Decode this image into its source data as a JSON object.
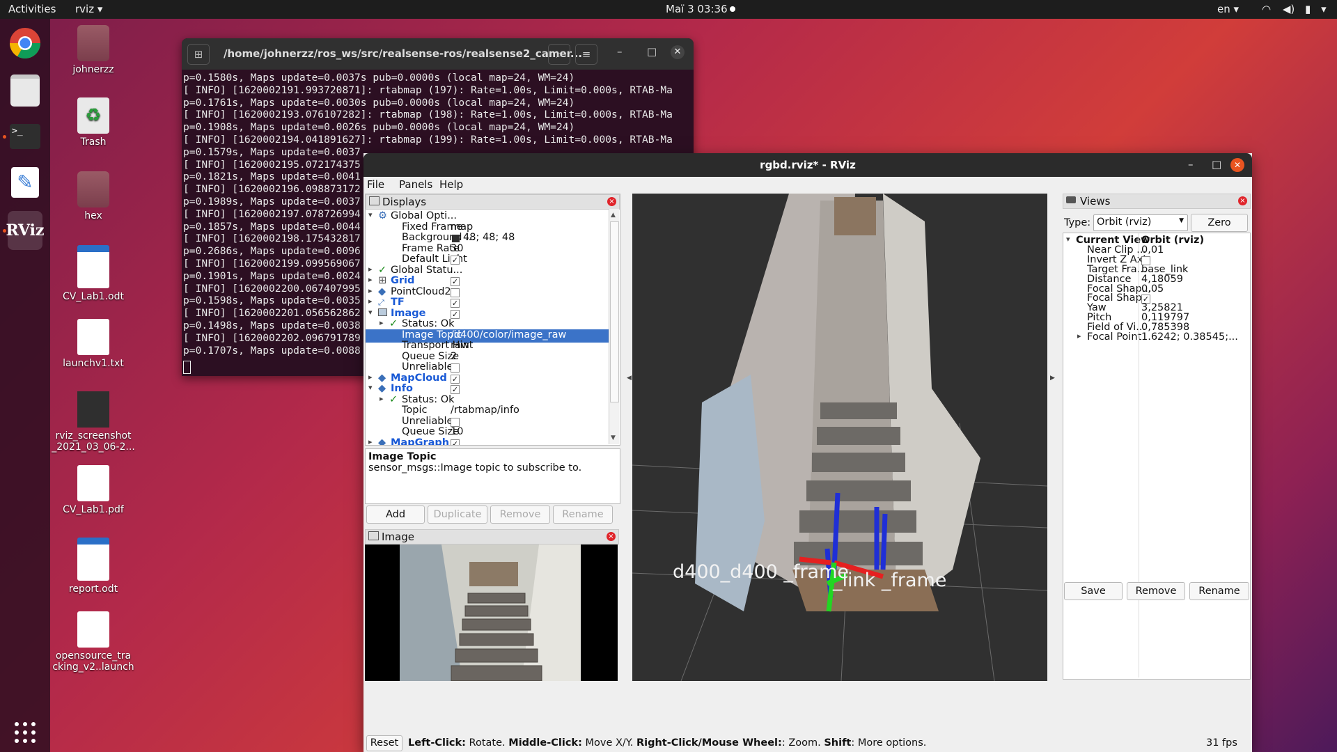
{
  "topbar": {
    "activities": "Activities",
    "app": "rviz ▾",
    "clock": "Маї 3  03:36",
    "lang": "en ▾"
  },
  "desktop": [
    {
      "label": "johnerzz"
    },
    {
      "label": "Trash"
    },
    {
      "label": "hex"
    },
    {
      "label": "CV_Lab1.odt"
    },
    {
      "label": "launchv1.txt"
    },
    {
      "label": "rviz_screenshot\n_2021_03_06-2..."
    },
    {
      "label": "CV_Lab1.pdf"
    },
    {
      "label": "report.odt"
    },
    {
      "label": "opensource_tra\ncking_v2..launch"
    }
  ],
  "terminal": {
    "title": "/home/johnerzz/ros_ws/src/realsense-ros/realsense2_camer...",
    "lines": [
      "p=0.1580s, Maps update=0.0037s pub=0.0000s (local map=24, WM=24)",
      "[ INFO] [1620002191.993720871]: rtabmap (197): Rate=1.00s, Limit=0.000s, RTAB-Ma",
      "p=0.1761s, Maps update=0.0030s pub=0.0000s (local map=24, WM=24)",
      "[ INFO] [1620002193.076107282]: rtabmap (198): Rate=1.00s, Limit=0.000s, RTAB-Ma",
      "p=0.1908s, Maps update=0.0026s pub=0.0000s (local map=24, WM=24)",
      "[ INFO] [1620002194.041891627]: rtabmap (199): Rate=1.00s, Limit=0.000s, RTAB-Ma",
      "p=0.1579s, Maps update=0.0037",
      "[ INFO] [1620002195.072174375",
      "p=0.1821s, Maps update=0.0041",
      "[ INFO] [1620002196.098873172",
      "p=0.1989s, Maps update=0.0037",
      "[ INFO] [1620002197.078726994",
      "p=0.1857s, Maps update=0.0044",
      "[ INFO] [1620002198.175432817",
      "p=0.2686s, Maps update=0.0096",
      "[ INFO] [1620002199.099569067",
      "p=0.1901s, Maps update=0.0024",
      "[ INFO] [1620002200.067407995",
      "p=0.1598s, Maps update=0.0035",
      "[ INFO] [1620002201.056562862",
      "p=0.1498s, Maps update=0.0038",
      "[ INFO] [1620002202.096791789",
      "p=0.1707s, Maps update=0.0088"
    ]
  },
  "rviz": {
    "title": "rgbd.rviz* - RViz",
    "menu": [
      "File",
      "Panels",
      "Help"
    ],
    "displays_title": "Displays",
    "tree": [
      {
        "name": "Global Opti...",
        "value": ""
      },
      {
        "name": "Fixed Frame",
        "value": "map"
      },
      {
        "name": "Background ...",
        "value": "48; 48; 48"
      },
      {
        "name": "Frame Rate",
        "value": "30"
      },
      {
        "name": "Default Light",
        "value": ""
      },
      {
        "name": "Global Statu...",
        "value": ""
      },
      {
        "name": "Grid",
        "value": ""
      },
      {
        "name": "PointCloud2",
        "value": ""
      },
      {
        "name": "TF",
        "value": ""
      },
      {
        "name": "Image",
        "value": ""
      },
      {
        "name": "Status: Ok",
        "value": ""
      },
      {
        "name": "Image Topic",
        "value": "/d400/color/image_raw"
      },
      {
        "name": "Transport Hint",
        "value": "raw"
      },
      {
        "name": "Queue Size",
        "value": "2"
      },
      {
        "name": "Unreliable",
        "value": ""
      },
      {
        "name": "MapCloud",
        "value": ""
      },
      {
        "name": "Info",
        "value": ""
      },
      {
        "name": "Status: Ok",
        "value": ""
      },
      {
        "name": "Topic",
        "value": "/rtabmap/info"
      },
      {
        "name": "Unreliable",
        "value": ""
      },
      {
        "name": "Queue Size",
        "value": "10"
      },
      {
        "name": "MapGraph",
        "value": ""
      }
    ],
    "desc_title": "Image Topic",
    "desc_text": "sensor_msgs::Image topic to subscribe to.",
    "buttons": {
      "add": "Add",
      "duplicate": "Duplicate",
      "remove": "Remove",
      "rename": "Rename"
    },
    "image_panel_title": "Image",
    "viewport_label_1": "d400_d400   _frame",
    "viewport_label_2": "_link  _frame",
    "views_title": "Views",
    "views_type_label": "Type:",
    "views_type_value": "Orbit (rviz)",
    "views_zero": "Zero",
    "views": [
      {
        "name": "Current View",
        "value": "Orbit (rviz)"
      },
      {
        "name": "Near Clip ...",
        "value": "0,01"
      },
      {
        "name": "Invert Z Axis",
        "value": ""
      },
      {
        "name": "Target Fra...",
        "value": "base_link"
      },
      {
        "name": "Distance",
        "value": "4,18059"
      },
      {
        "name": "Focal Shap...",
        "value": "0,05"
      },
      {
        "name": "Focal Shap...",
        "value": ""
      },
      {
        "name": "Yaw",
        "value": "3,25821"
      },
      {
        "name": "Pitch",
        "value": "0,119797"
      },
      {
        "name": "Field of Vi...",
        "value": "0,785398"
      },
      {
        "name": "Focal Point",
        "value": "1.6242; 0.38545;..."
      }
    ],
    "views_buttons": {
      "save": "Save",
      "remove": "Remove",
      "rename": "Rename"
    },
    "status": {
      "reset": "Reset",
      "b1": "Left-Click:",
      "t1": " Rotate. ",
      "b2": "Middle-Click:",
      "t2": " Move X/Y. ",
      "b3": "Right-Click/Mouse Wheel:",
      "t3": ": Zoom. ",
      "b4": "Shift",
      "t4": ": More options.",
      "fps": "31 fps"
    }
  }
}
